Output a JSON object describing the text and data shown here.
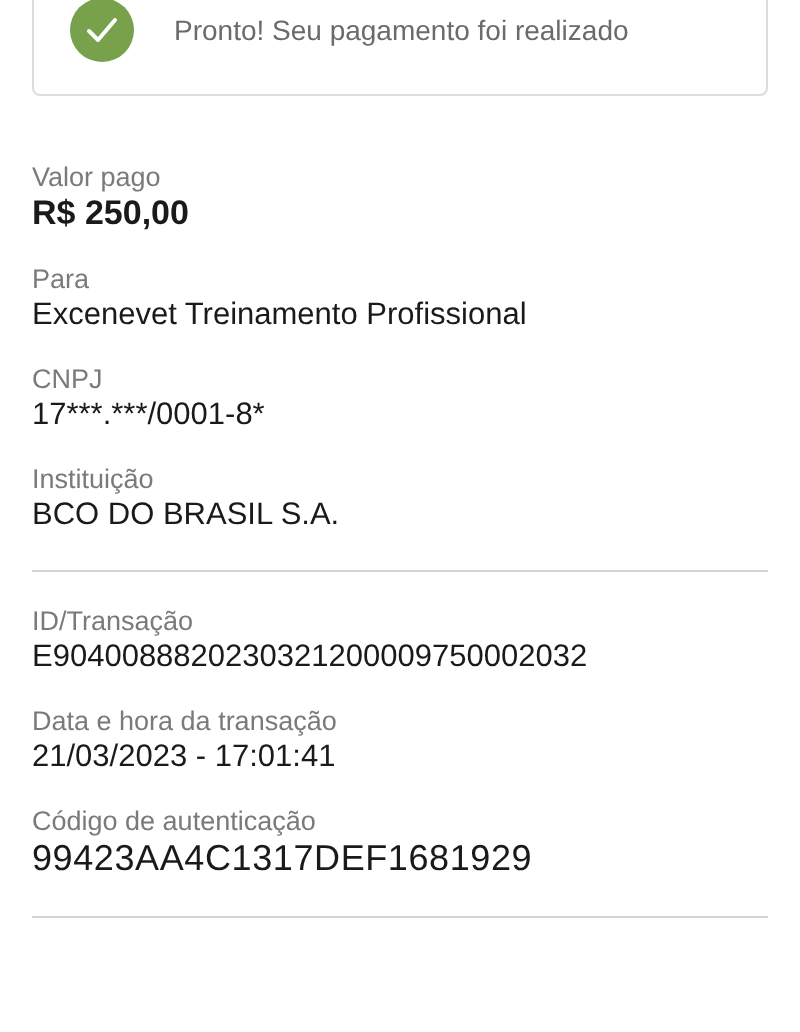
{
  "banner": {
    "message": "Pronto! Seu pagamento foi realizado"
  },
  "sections": [
    {
      "fields": [
        {
          "label": "Valor pago",
          "value": "R$ 250,00",
          "kind": "amount"
        },
        {
          "label": "Para",
          "value": "Excenevet Treinamento Profissional",
          "kind": "plain"
        },
        {
          "label": "CNPJ",
          "value": "17***.***/0001-8*",
          "kind": "plain"
        },
        {
          "label": "Instituição",
          "value": "BCO DO BRASIL S.A.",
          "kind": "plain"
        }
      ]
    },
    {
      "fields": [
        {
          "label": "ID/Transação",
          "value": "E9040088820230321200009750002032",
          "kind": "plain"
        },
        {
          "label": "Data e hora da transação",
          "value": "21/03/2023 - 17:01:41",
          "kind": "plain"
        },
        {
          "label": "Código de autenticação",
          "value": "99423AA4C1317DEF1681929",
          "kind": "code"
        }
      ]
    }
  ]
}
